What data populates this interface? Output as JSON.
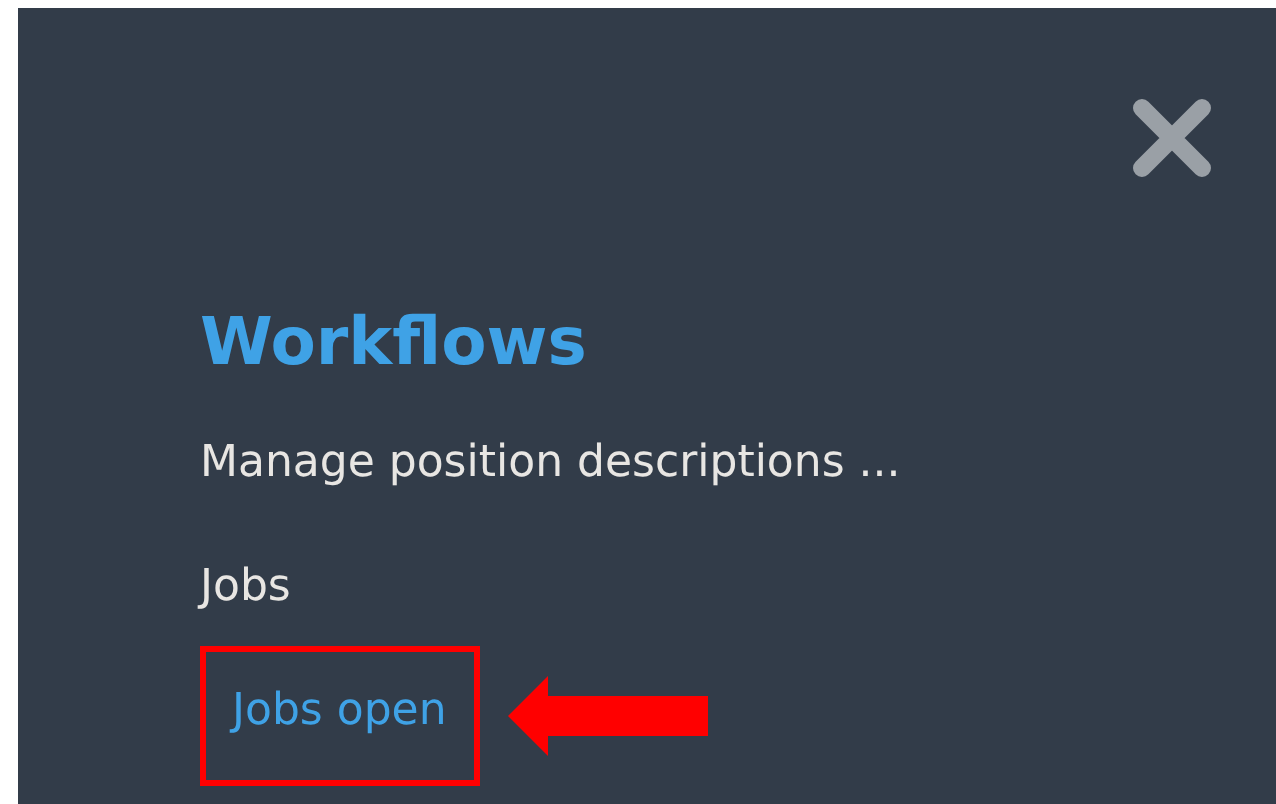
{
  "panel": {
    "title": "Workflows",
    "items": [
      {
        "label": "Manage position descriptions ...",
        "active": false,
        "highlighted": false
      },
      {
        "label": "Jobs",
        "active": false,
        "highlighted": false
      },
      {
        "label": "Jobs open",
        "active": true,
        "highlighted": true
      }
    ]
  }
}
